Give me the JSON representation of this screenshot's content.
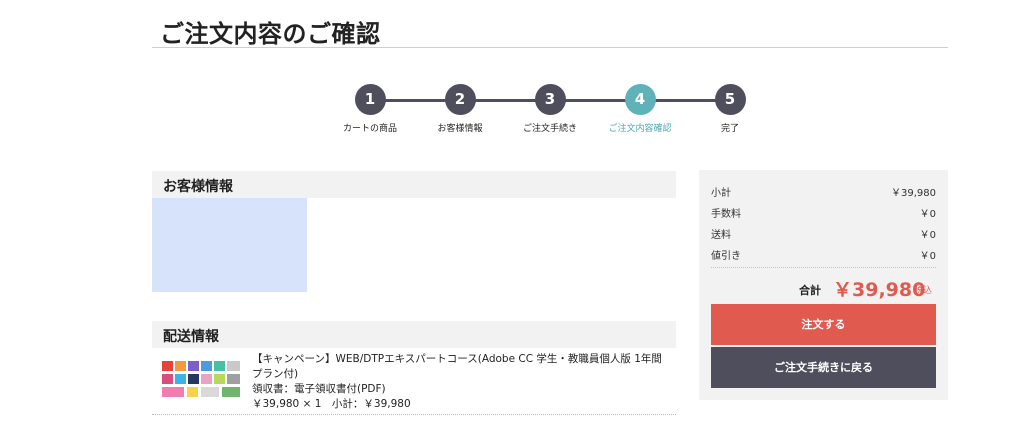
{
  "page": {
    "title": "ご注文内容のご確認"
  },
  "steps": [
    {
      "number": "1",
      "label": "カートの商品"
    },
    {
      "number": "2",
      "label": "お客様情報"
    },
    {
      "number": "3",
      "label": "ご注文手続き"
    },
    {
      "number": "4",
      "label": "ご注文内容確認"
    },
    {
      "number": "5",
      "label": "完了"
    }
  ],
  "active_step": 4,
  "colors": {
    "step_dark": "#4f4e5c",
    "step_active": "#5fb3b8",
    "accent_red": "#e05a50",
    "panel_bg": "#f2f2f2",
    "placeholder_blue": "#d6e3fb"
  },
  "customer": {
    "header": "お客様情報"
  },
  "shipping": {
    "header": "配送情報",
    "item": {
      "name": "【キャンペーン】WEB/DTPエキスパートコース(Adobe CC 学生・教職員個人版 1年間プラン付)",
      "receipt": "領収書：電子領収書付(PDF)",
      "price_line": "￥39,980 × 1　小計：￥39,980"
    }
  },
  "summary": {
    "rows": [
      {
        "label": "小計",
        "value": "￥39,980"
      },
      {
        "label": "手数料",
        "value": "￥0"
      },
      {
        "label": "送料",
        "value": "￥0"
      },
      {
        "label": "値引き",
        "value": "￥0"
      }
    ],
    "total_label": "合計",
    "total_value": "￥39,980",
    "tax_label": "税込",
    "order_button": "注文する",
    "back_button": "ご注文手続きに戻る"
  }
}
